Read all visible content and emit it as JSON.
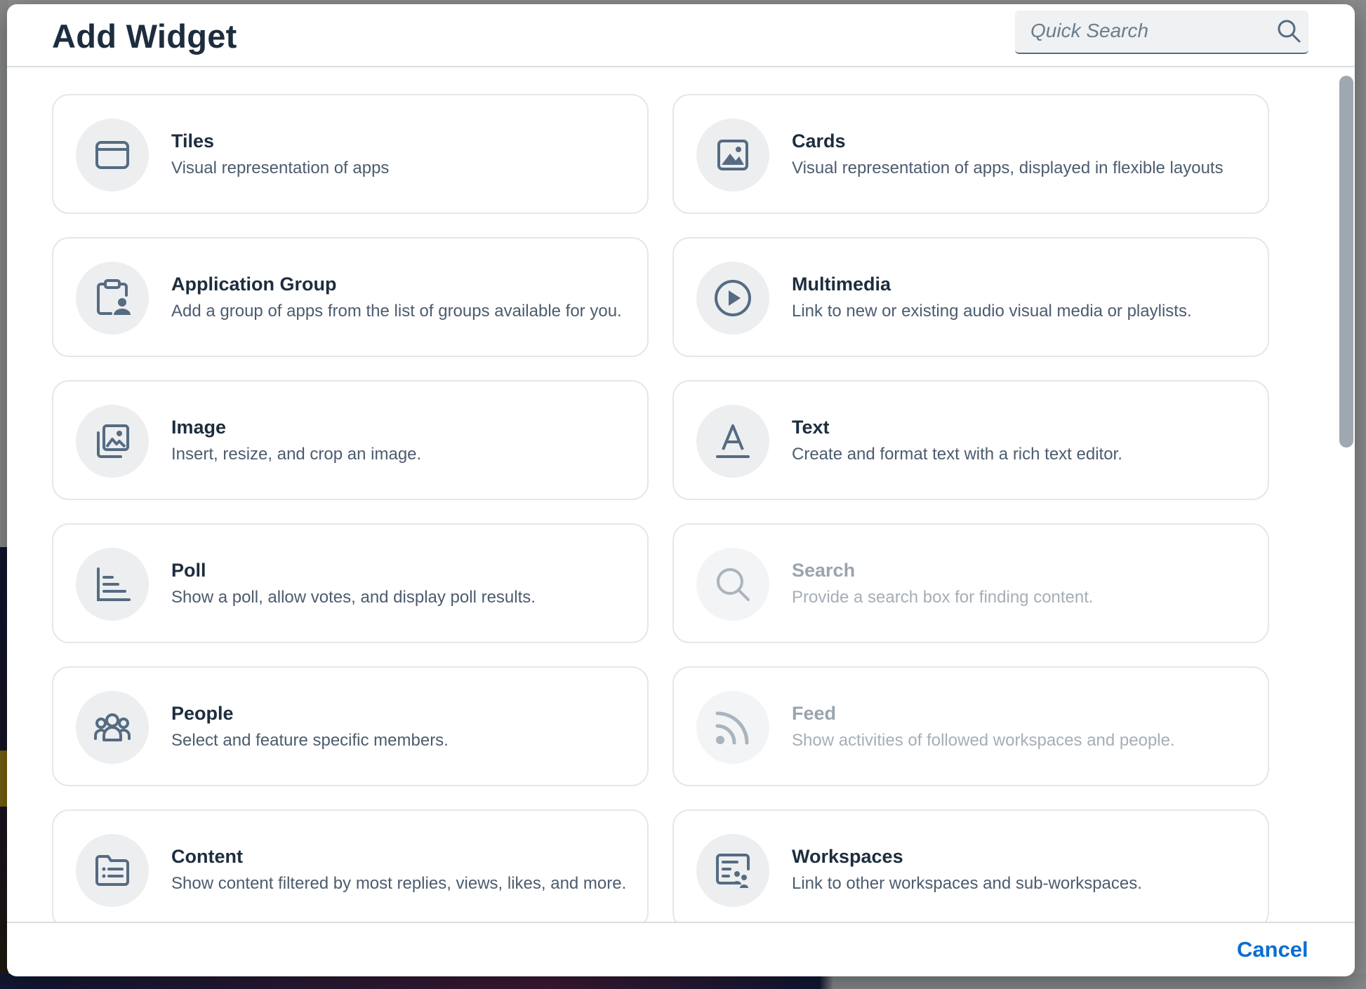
{
  "dialog": {
    "title": "Add Widget",
    "search": {
      "placeholder": "Quick Search",
      "value": ""
    },
    "cancel_label": "Cancel"
  },
  "widgets": [
    {
      "title": "Tiles",
      "description": "Visual representation of apps",
      "icon": "tiles-icon",
      "enabled": true
    },
    {
      "title": "Cards",
      "description": "Visual representation of apps, displayed in flexible layouts",
      "icon": "cards-icon",
      "enabled": true
    },
    {
      "title": "Application Group",
      "description": "Add a group of apps from the list of groups available for you.",
      "icon": "application-group-icon",
      "enabled": true
    },
    {
      "title": "Multimedia",
      "description": "Link to new or existing audio visual media or playlists.",
      "icon": "play-icon",
      "enabled": true
    },
    {
      "title": "Image",
      "description": "Insert, resize, and crop an image.",
      "icon": "image-icon",
      "enabled": true
    },
    {
      "title": "Text",
      "description": "Create and format text with a rich text editor.",
      "icon": "text-format-icon",
      "enabled": true
    },
    {
      "title": "Poll",
      "description": "Show a poll, allow votes, and display poll results.",
      "icon": "poll-icon",
      "enabled": true
    },
    {
      "title": "Search",
      "description": "Provide a search box for finding content.",
      "icon": "search-icon",
      "enabled": false
    },
    {
      "title": "People",
      "description": "Select and feature specific members.",
      "icon": "people-icon",
      "enabled": true
    },
    {
      "title": "Feed",
      "description": "Show activities of followed workspaces and people.",
      "icon": "feed-icon",
      "enabled": false
    },
    {
      "title": "Content",
      "description": "Show content filtered by most replies, views, likes, and more.",
      "icon": "content-list-icon",
      "enabled": true
    },
    {
      "title": "Workspaces",
      "description": "Link to other workspaces and sub-workspaces.",
      "icon": "workspaces-icon",
      "enabled": true
    }
  ],
  "colors": {
    "title_text": "#1d2d3e",
    "description_text": "#4c5c6e",
    "icon": "#556b82",
    "icon_disabled": "#a9b4be",
    "accent": "#0a6ed1"
  }
}
